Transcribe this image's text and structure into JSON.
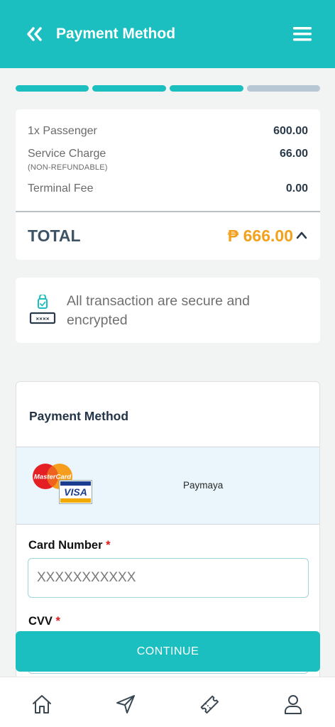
{
  "header": {
    "title": "Payment Method",
    "back_icon": "double-chevron-left-icon",
    "menu_icon": "hamburger-menu-icon",
    "background": "#1bbfbf"
  },
  "progress": {
    "total_steps": 4,
    "completed_steps": 3,
    "active_color": "#1bbfbf",
    "inactive_color": "#b7c7d3"
  },
  "summary": {
    "items": [
      {
        "label": "1x Passenger",
        "sublabel": "",
        "value": "600.00"
      },
      {
        "label": "Service Charge",
        "sublabel": "(NON-REFUNDABLE)",
        "value": "66.00"
      },
      {
        "label": "Terminal Fee",
        "sublabel": "",
        "value": "0.00"
      }
    ],
    "total_label": "TOTAL",
    "total_value": "₱ 666.00",
    "total_color": "#f2a11d"
  },
  "security": {
    "icon": "lock-password-icon",
    "text": "All transaction are secure and encrypted"
  },
  "payment": {
    "title": "Payment Method",
    "option": {
      "logos": [
        "mastercard-logo",
        "visa-logo"
      ],
      "mastercard_text": "MasterCard",
      "visa_text": "VISA",
      "label": "Paymaya"
    },
    "card_number": {
      "label": "Card Number",
      "required_mark": "*",
      "value": "",
      "placeholder": "XXXXXXXXXXX"
    },
    "cvv": {
      "label": "CVV",
      "required_mark": "*",
      "value": "",
      "placeholder": ""
    }
  },
  "continue_label": "CONTINUE",
  "bottom_nav": [
    {
      "name": "home",
      "icon": "home-icon"
    },
    {
      "name": "send",
      "icon": "send-icon"
    },
    {
      "name": "tickets",
      "icon": "ticket-icon"
    },
    {
      "name": "profile",
      "icon": "user-icon"
    }
  ]
}
